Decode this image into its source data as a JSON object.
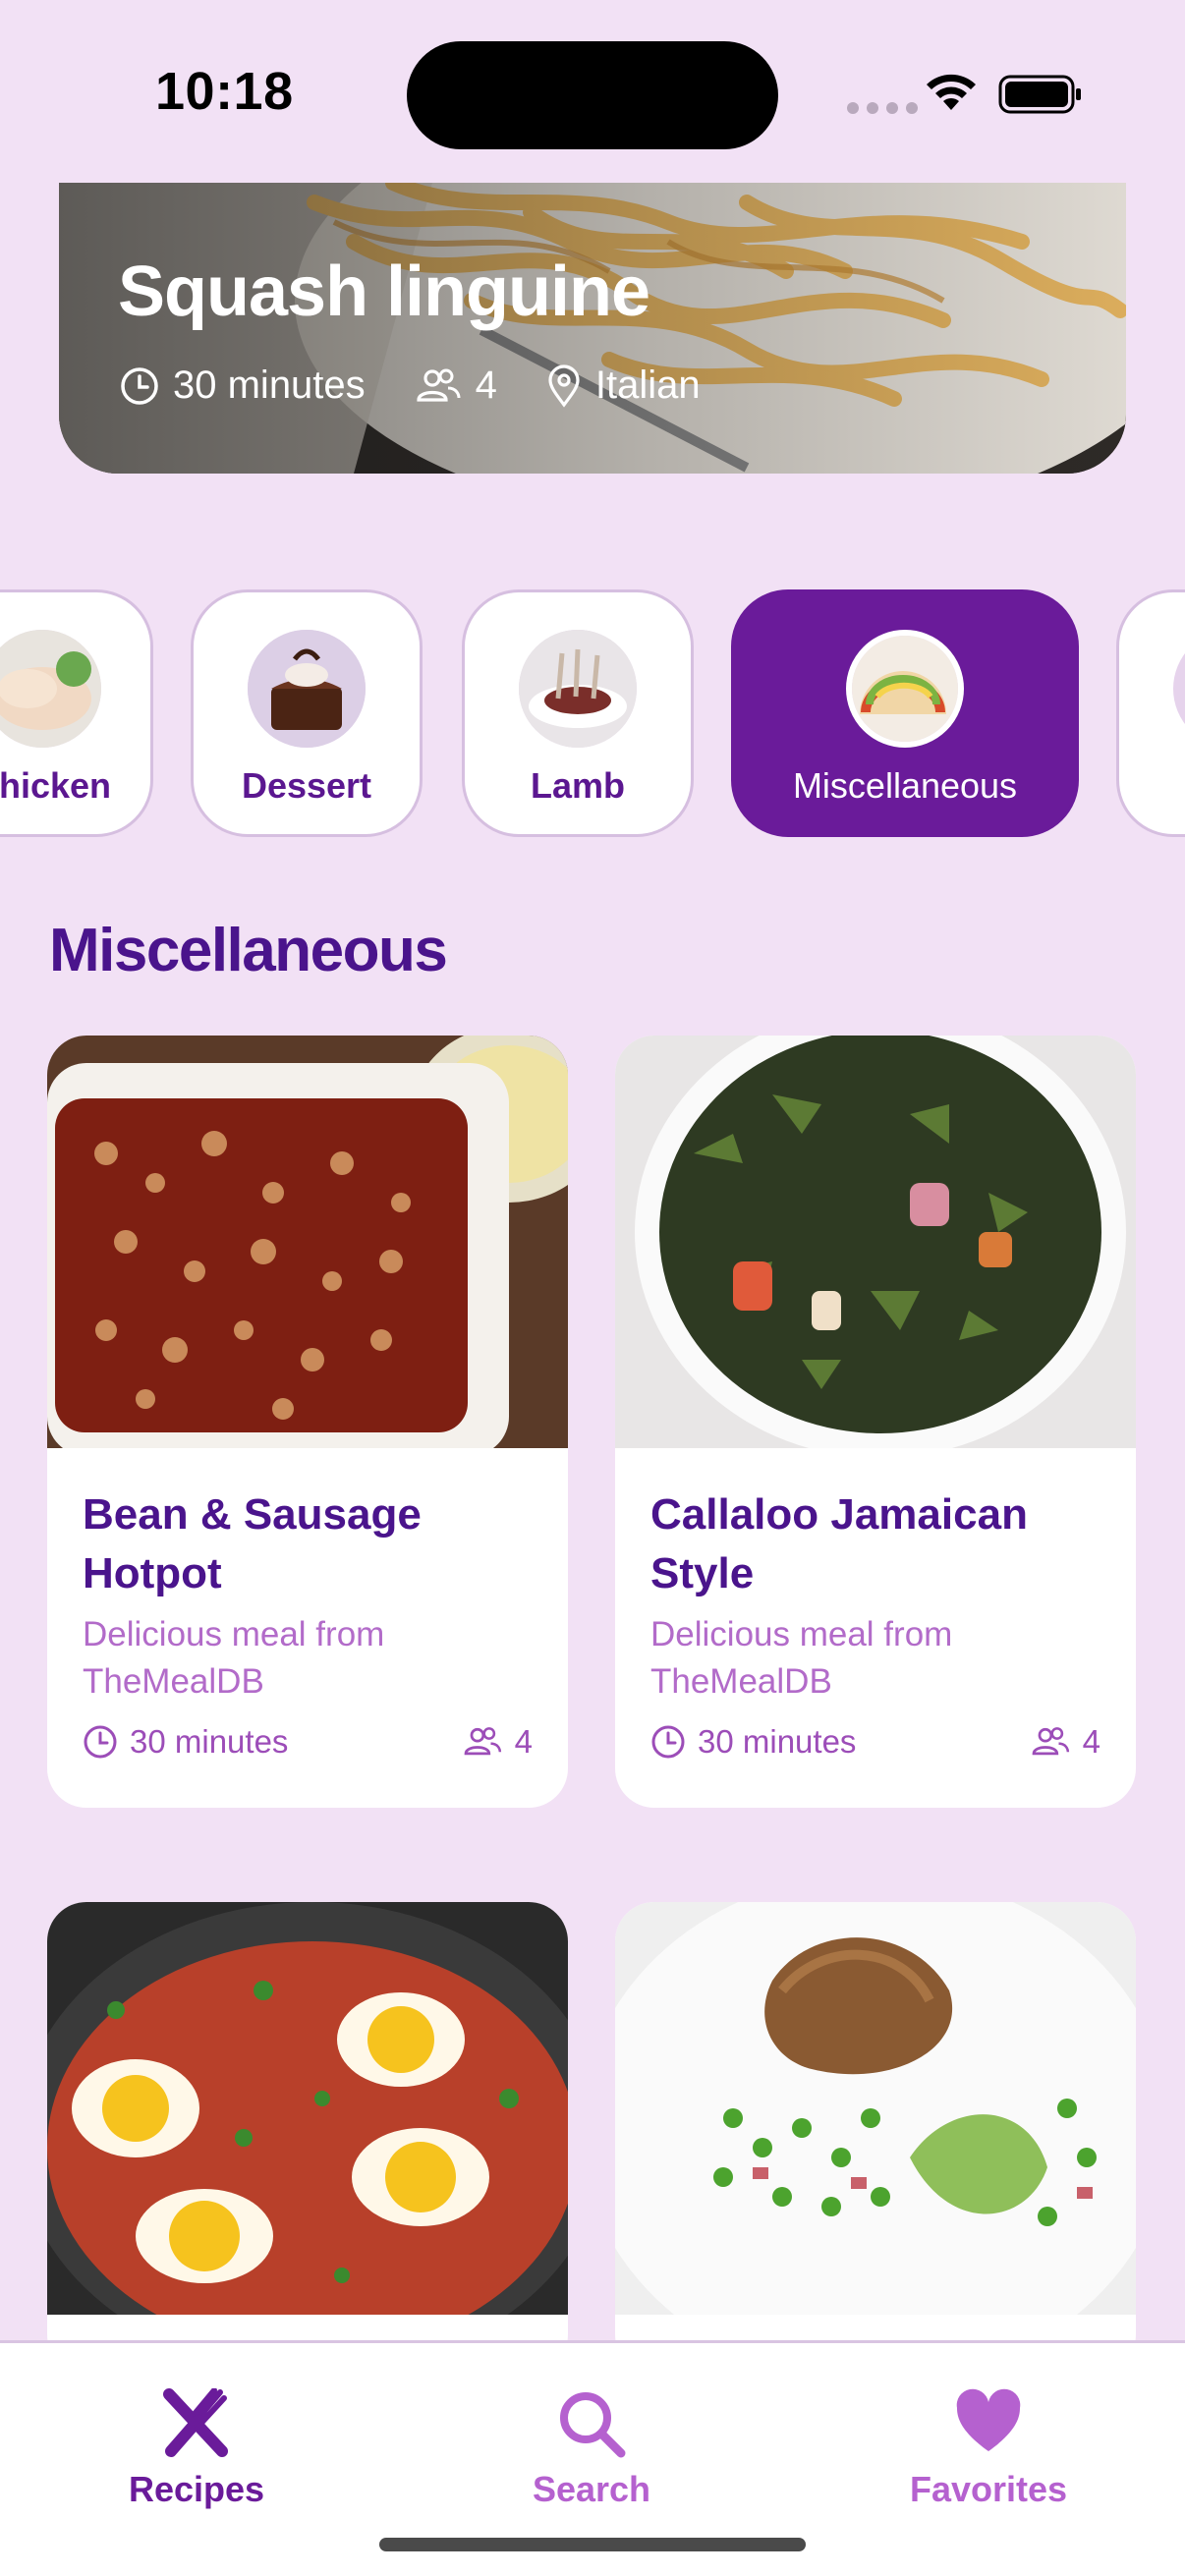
{
  "status": {
    "time": "10:18"
  },
  "hero": {
    "title": "Squash linguine",
    "time": "30 minutes",
    "servings": "4",
    "cuisine": "Italian"
  },
  "categories": [
    {
      "label": "Chicken",
      "icon": "chicken-image",
      "active": false
    },
    {
      "label": "Dessert",
      "icon": "dessert-image",
      "active": false
    },
    {
      "label": "Lamb",
      "icon": "lamb-image",
      "active": false
    },
    {
      "label": "Miscellaneous",
      "icon": "tacos-image",
      "active": true
    }
  ],
  "section_title": "Miscellaneous",
  "recipes": [
    {
      "name": "Bean & Sausage Hotpot",
      "desc": "Delicious meal from TheMealDB",
      "time": "30 minutes",
      "servings": "4"
    },
    {
      "name": "Callaloo Jamaican Style",
      "desc": "Delicious meal from TheMealDB",
      "time": "30 minutes",
      "servings": "4"
    },
    {
      "name": "",
      "desc": "",
      "time": "",
      "servings": ""
    },
    {
      "name": "",
      "desc": "",
      "time": "",
      "servings": ""
    }
  ],
  "tabs": [
    {
      "label": "Recipes",
      "icon": "utensils-icon",
      "active": true
    },
    {
      "label": "Search",
      "icon": "search-icon",
      "active": false
    },
    {
      "label": "Favorites",
      "icon": "heart-icon",
      "active": false
    }
  ],
  "colors": {
    "accent": "#6A1B9A",
    "background": "#F2E1F5",
    "title": "#4A148C",
    "muted": "#B26BC9"
  }
}
